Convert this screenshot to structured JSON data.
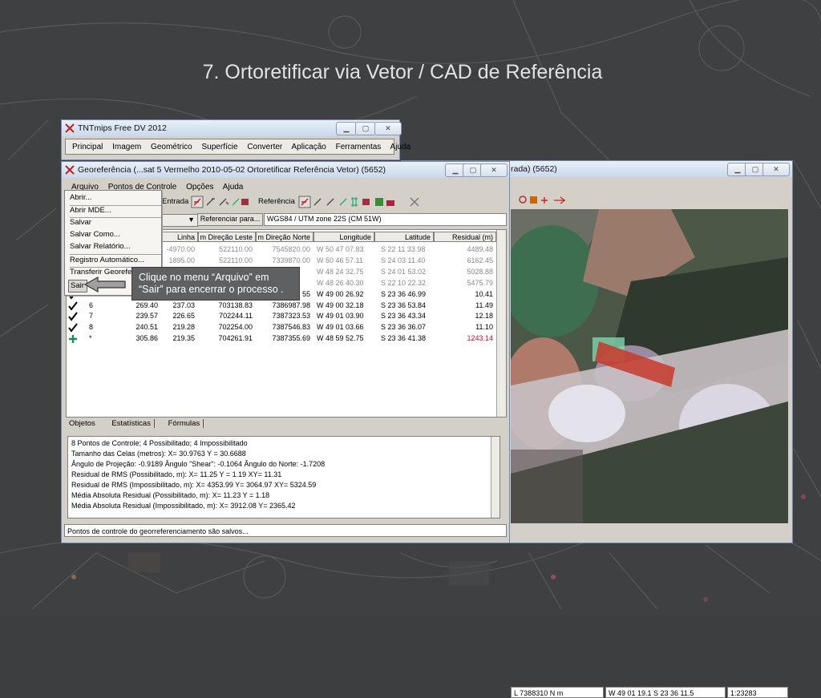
{
  "slide": {
    "title": "7. Ortoretificar via Vetor / CAD de Referência"
  },
  "tntmips": {
    "title": "TNTmips Free DV 2012",
    "menu": [
      "Principal",
      "Imagem",
      "Geométrico",
      "Superfície",
      "Converter",
      "Aplicação",
      "Ferramentas",
      "Ajuda"
    ]
  },
  "georef": {
    "title": "Georeferência (...sat 5 Vermelho 2010-05-02 Ortoretificar Referência Vetor) (5652)",
    "menu": [
      "Arquivo",
      "Pontos de Controle",
      "Opções",
      "Ajuda"
    ],
    "toolbar": {
      "input_label": "Entrada",
      "reference_label": "Referência"
    },
    "ref_button": "Referenciar para...",
    "projection": "WGS84 / UTM zone 22S (CM 51W)",
    "columns": [
      "Linha",
      "m Direção Leste",
      "m Direção Norte",
      "Longitude",
      "Latitude",
      "Residual (m)"
    ],
    "rows": [
      {
        "linha": "-4970.00",
        "leste": "522110.00",
        "norte": "7545820.00",
        "lon": "W 50 47 07.83",
        "lat": "S 22 11 33.98",
        "res": "4489.48"
      },
      {
        "linha": "1895.00",
        "leste": "522110.00",
        "norte": "7339870.00",
        "lon": "W 50 46 57.11",
        "lat": "S 24 03 11.40",
        "res": "6162.45"
      },
      {
        "linha": "",
        "leste": "",
        "norte": "",
        "lon": "W 48 24 32.75",
        "lat": "S 24 01 53.02",
        "res": "5028.88"
      },
      {
        "linha": "",
        "leste": "",
        "norte": "",
        "lon": "W 48 26 40.30",
        "lat": "S 22 10 22.32",
        "res": "5475.79"
      },
      {
        "num": "5",
        "col": "27",
        "linha": "",
        "leste": "",
        "norte": "55",
        "lon": "W 49 00 26.92",
        "lat": "S 23 36 46.99",
        "res": "10.41"
      },
      {
        "num": "6",
        "col": "269.40",
        "linha": "237.03",
        "leste": "703138.83",
        "norte": "7386987.98",
        "lon": "W 49 00 32.18",
        "lat": "S 23 36 53.84",
        "res": "11.49"
      },
      {
        "num": "7",
        "col": "239.57",
        "linha": "226.65",
        "leste": "702244.11",
        "norte": "7387323.53",
        "lon": "W 49 01 03.90",
        "lat": "S 23 36 43.34",
        "res": "12.18"
      },
      {
        "num": "8",
        "col": "240.51",
        "linha": "219.28",
        "leste": "702254.00",
        "norte": "7387546.83",
        "lon": "W 49 01 03.66",
        "lat": "S 23 36 36.07",
        "res": "11.10"
      },
      {
        "num": "*",
        "col": "305.86",
        "linha": "219.35",
        "leste": "704261.91",
        "norte": "7387355.69",
        "lon": "W 48 59 52.75",
        "lat": "S 23 36 41.38",
        "res": "1243.14"
      }
    ],
    "tabs": [
      "Objetos",
      "Estatísticas",
      "Fórmulas"
    ],
    "stats": [
      "8 Pontos de Controle;  4 Possibilitado;  4 Impossibilitado",
      "Tamanho das Celas (metros):  X= 30.9763  Y = 30.6688",
      "Ângulo de Projeção: -0.9189  Ângulo \"Shear\": -0.1064  Ângulo do Norte: -1.7208",
      "Residual de RMS (Possibilitado, m):  X= 11.25  Y = 1.19  XY= 11.31",
      "Residual de RMS (Impossibilitado, m):  X= 4353.99  Y= 3064.97  XY= 5324.59",
      "Média Absoluta Residual (Possibilitado, m):  X= 11.23  Y = 1.18",
      "Média Absoluta Residual (Impossibilitado, m):  X= 3912.08  Y= 2365.42"
    ],
    "status": "Pontos de controle do georreferenciamento são salvos..."
  },
  "file_menu": {
    "items": [
      "Abrir...",
      "Abrir MDE...",
      "Salvar",
      "Salvar Como...",
      "Salvar Relatório...",
      "Registro Automático...",
      "Transferir Georefe",
      "Sair"
    ]
  },
  "callout": {
    "text": "Clique no menu “Arquivo” em “Sair” para encerrar o processo ."
  },
  "ref_window": {
    "title": "rada) (5652)",
    "status_coord": "L 7388310 N m",
    "status_lonlat": "W 49 01 19.1  S 23 36 11.5",
    "status_scale": "1:23283"
  }
}
